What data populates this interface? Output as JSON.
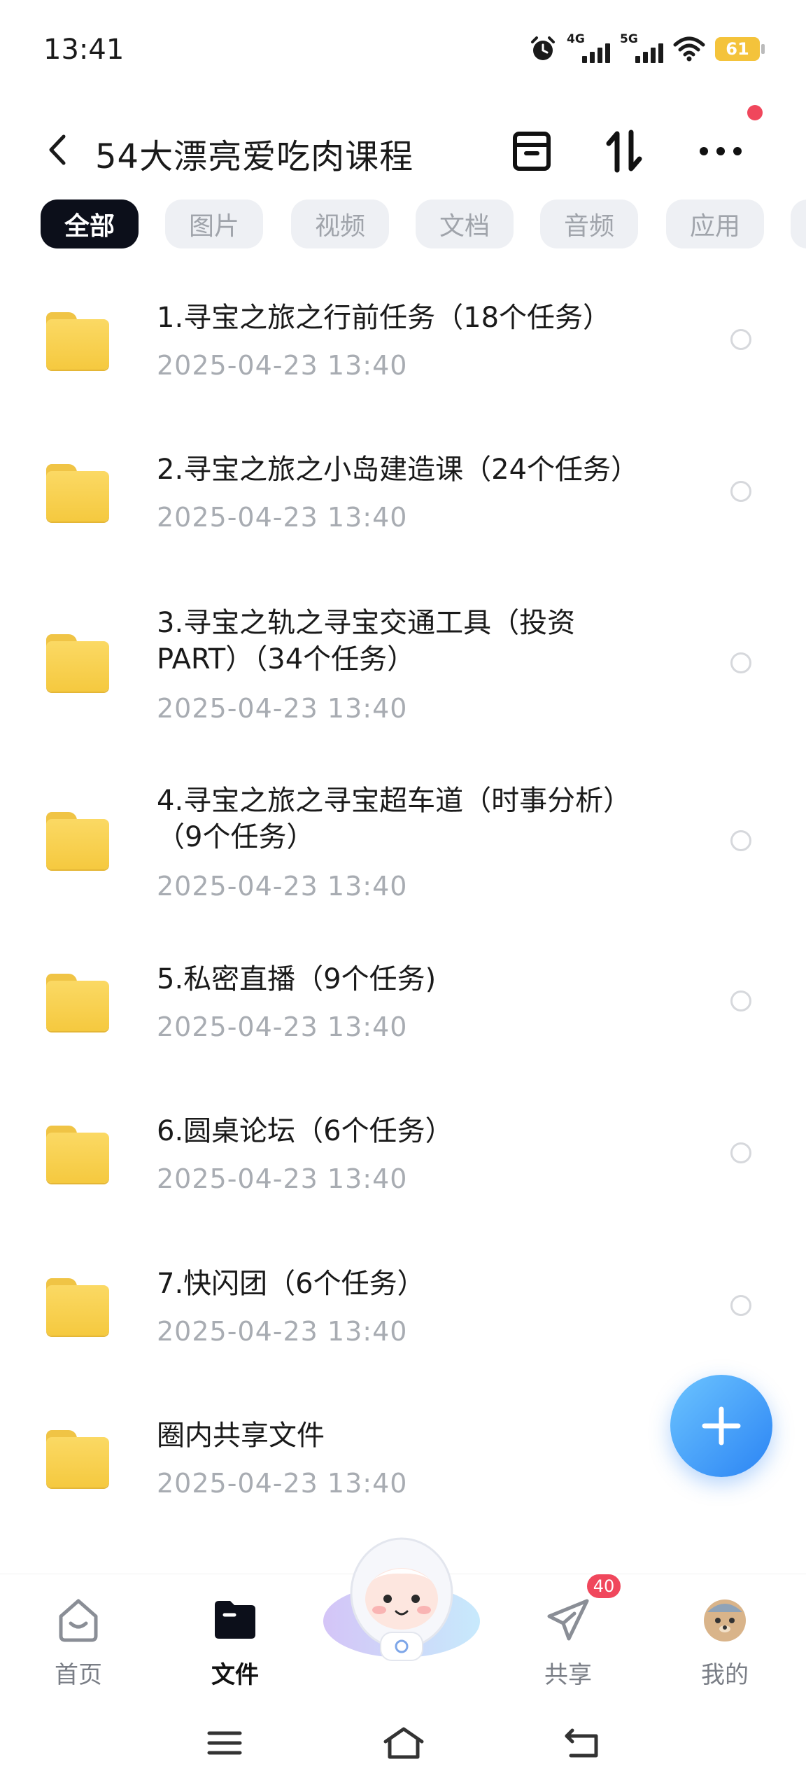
{
  "status_bar": {
    "time": "13:41",
    "network_1": "4G",
    "network_2": "5G",
    "battery": "61"
  },
  "header": {
    "title": "54大漂亮爱吃肉课程",
    "icons": [
      "back-icon",
      "archive-icon",
      "sort-icon",
      "more-icon"
    ]
  },
  "tabs": [
    {
      "label": "全部",
      "active": true
    },
    {
      "label": "图片",
      "active": false
    },
    {
      "label": "视频",
      "active": false
    },
    {
      "label": "文档",
      "active": false
    },
    {
      "label": "音频",
      "active": false
    },
    {
      "label": "应用",
      "active": false
    }
  ],
  "files": [
    {
      "name": "1.寻宝之旅之行前任务（18个任务）",
      "date": "2025-04-23  13:40"
    },
    {
      "name": "2.寻宝之旅之小岛建造课（24个任务）",
      "date": "2025-04-23  13:40"
    },
    {
      "name": "3.寻宝之轨之寻宝交通工具（投资PART）（34个任务）",
      "date": "2025-04-23  13:40"
    },
    {
      "name": "4.寻宝之旅之寻宝超车道（时事分析）（9个任务）",
      "date": "2025-04-23  13:40"
    },
    {
      "name": "5.私密直播（9个任务)",
      "date": "2025-04-23  13:40"
    },
    {
      "name": "6.圆桌论坛（6个任务）",
      "date": "2025-04-23  13:40"
    },
    {
      "name": "7.快闪团（6个任务）",
      "date": "2025-04-23  13:40"
    },
    {
      "name": "圈内共享文件",
      "date": "2025-04-23  13:40"
    }
  ],
  "bottom_nav": {
    "home": "首页",
    "files": "文件",
    "share": "共享",
    "share_badge": "40",
    "mine": "我的"
  },
  "colors": {
    "accent_dark": "#0c0f1a",
    "folder": "#f5c93f",
    "fab": "#2b84f4",
    "badge": "#f0475c"
  }
}
